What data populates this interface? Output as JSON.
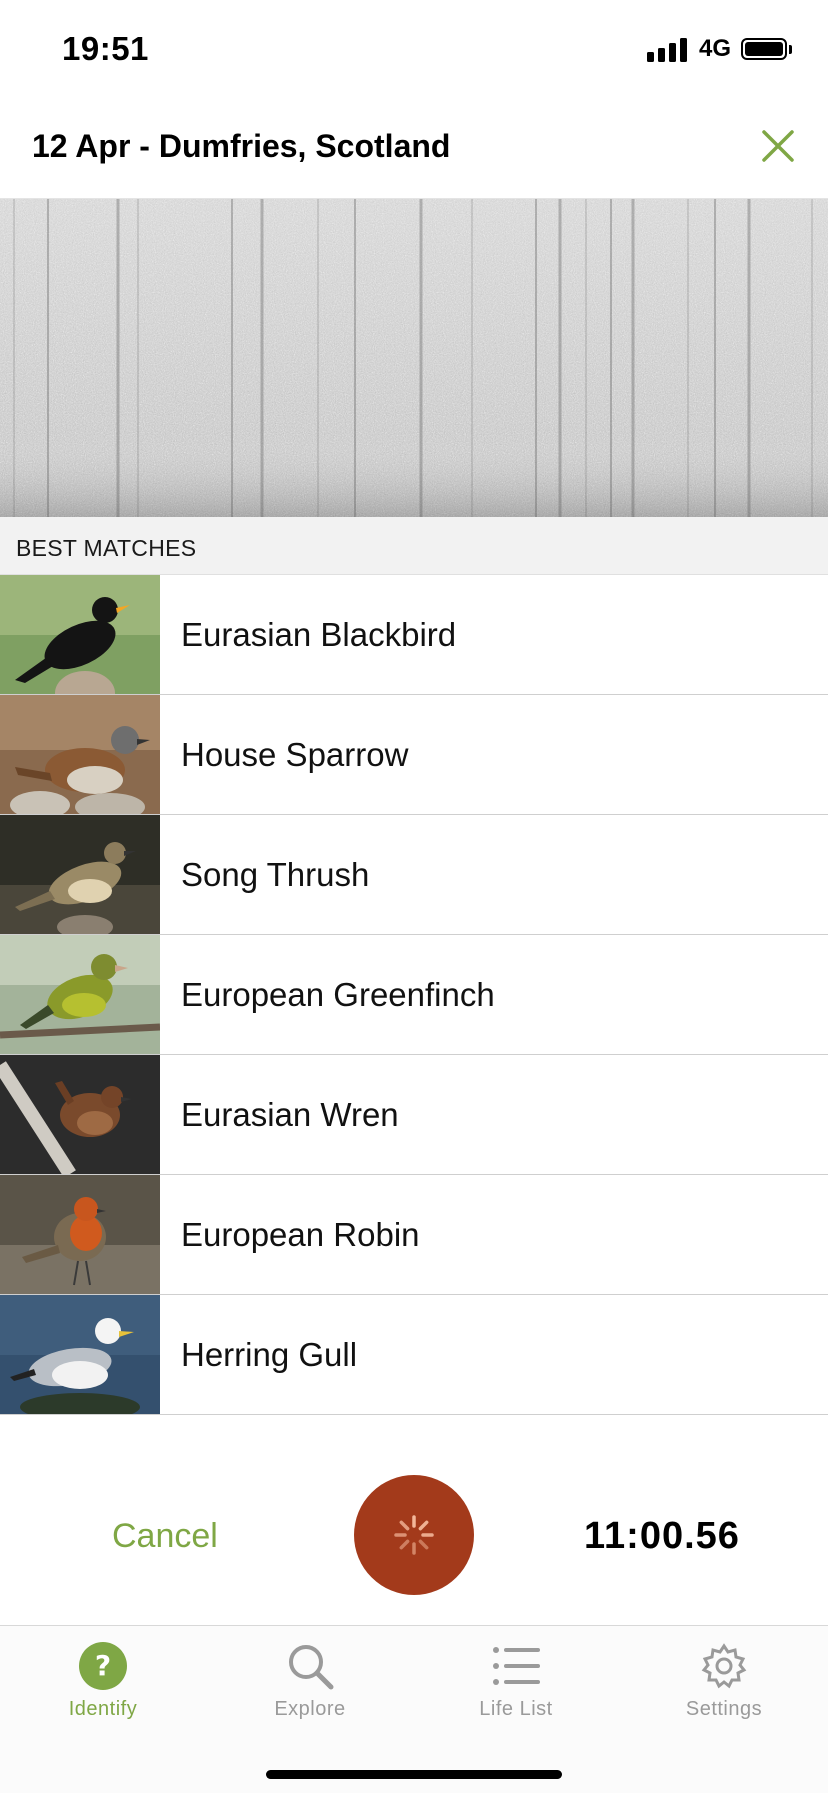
{
  "status_bar": {
    "time": "19:51",
    "network": "4G"
  },
  "header": {
    "title": "12 Apr - Dumfries, Scotland"
  },
  "section": {
    "title": "BEST MATCHES"
  },
  "matches": [
    {
      "name": "Eurasian Blackbird"
    },
    {
      "name": "House Sparrow"
    },
    {
      "name": "Song Thrush"
    },
    {
      "name": "European Greenfinch"
    },
    {
      "name": "Eurasian Wren"
    },
    {
      "name": "European Robin"
    },
    {
      "name": "Herring Gull"
    }
  ],
  "controls": {
    "cancel_label": "Cancel",
    "timer": "11:00.56"
  },
  "tabs": [
    {
      "label": "Identify",
      "icon": "question-icon",
      "active": true
    },
    {
      "label": "Explore",
      "icon": "search-icon",
      "active": false
    },
    {
      "label": "Life List",
      "icon": "list-icon",
      "active": false
    },
    {
      "label": "Settings",
      "icon": "gear-icon",
      "active": false
    }
  ],
  "colors": {
    "accent": "#7fa745",
    "record": "#a33a1b"
  }
}
